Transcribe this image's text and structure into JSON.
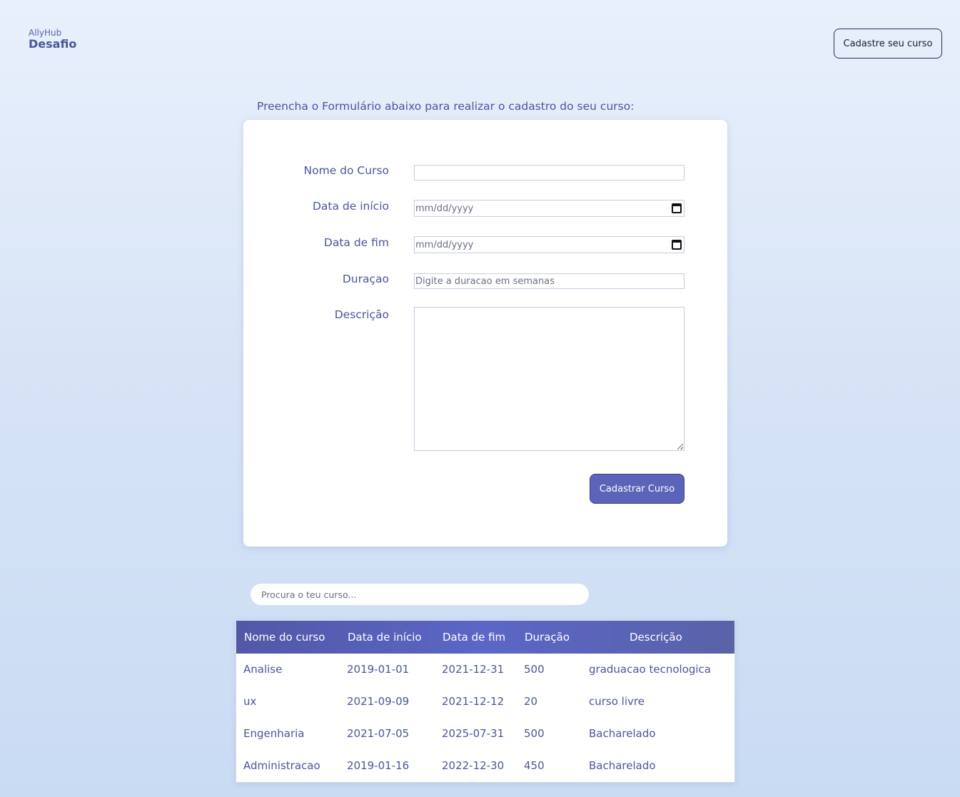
{
  "header": {
    "logo_small": "AllyHub",
    "logo_big": "Desafio",
    "nav_button": "Cadastre seu curso"
  },
  "intro": "Preencha o Formulário abaixo para realizar o cadastro do seu curso:",
  "form": {
    "fields": [
      {
        "label": "Nome do Curso",
        "value": "",
        "placeholder": ""
      },
      {
        "label": "Data de início",
        "value": "mm/dd/yyyy"
      },
      {
        "label": "Data de fim",
        "value": "mm/dd/yyyy"
      },
      {
        "label": "Duraçao",
        "placeholder": "Digite a duracao em semanas"
      },
      {
        "label": "Descrição",
        "value": ""
      }
    ],
    "submit_label": "Cadastrar Curso"
  },
  "search": {
    "placeholder": "Procura o teu curso..."
  },
  "table": {
    "headers": [
      "Nome do curso",
      "Data de início",
      "Data de fim",
      "Duração",
      "Descrição"
    ],
    "rows": [
      [
        "Analise",
        "2019-01-01",
        "2021-12-31",
        "500",
        "graduacao tecnologica"
      ],
      [
        "ux",
        "2021-09-09",
        "2021-12-12",
        "20",
        "curso livre"
      ],
      [
        "Engenharia",
        "2021-07-05",
        "2025-07-31",
        "500",
        "Bacharelado"
      ],
      [
        "Administracao",
        "2019-01-16",
        "2022-12-30",
        "450",
        "Bacharelado"
      ]
    ]
  },
  "colors": {
    "accent": "#5b64b8",
    "text": "#4a55a0"
  }
}
